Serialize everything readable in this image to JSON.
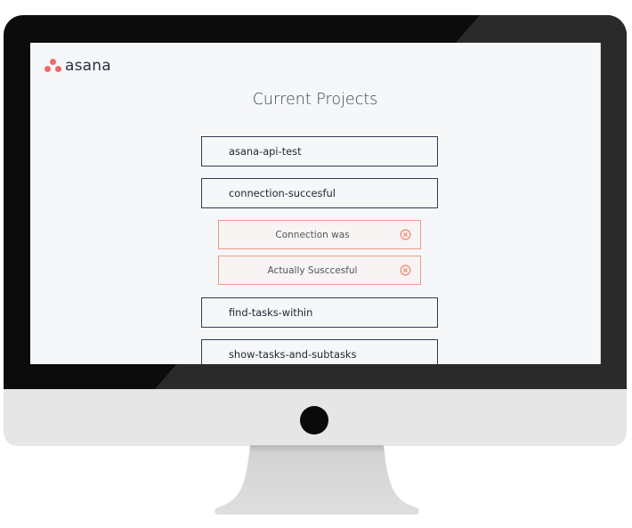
{
  "app": {
    "logo_text": "asana",
    "brand_color": "#f06a6a"
  },
  "page": {
    "title": "Current Projects"
  },
  "projects": [
    {
      "label": "asana-api-test"
    },
    {
      "label": "connection-succesful"
    },
    {
      "label": "find-tasks-within"
    },
    {
      "label": "show-tasks-and-subtasks"
    }
  ],
  "tasks": [
    {
      "label": "Connection was",
      "icon": "remove-circle-icon"
    },
    {
      "label": "Actually Susccesful",
      "icon": "remove-circle-icon"
    }
  ],
  "colors": {
    "project_border": "#2f3b52",
    "task_border": "#ee9a85",
    "remove_icon": "#f28a78",
    "monitor_bezel": "#0c0c0c",
    "monitor_chin": "#e6e6e6",
    "stand": "#d9d9d9"
  }
}
